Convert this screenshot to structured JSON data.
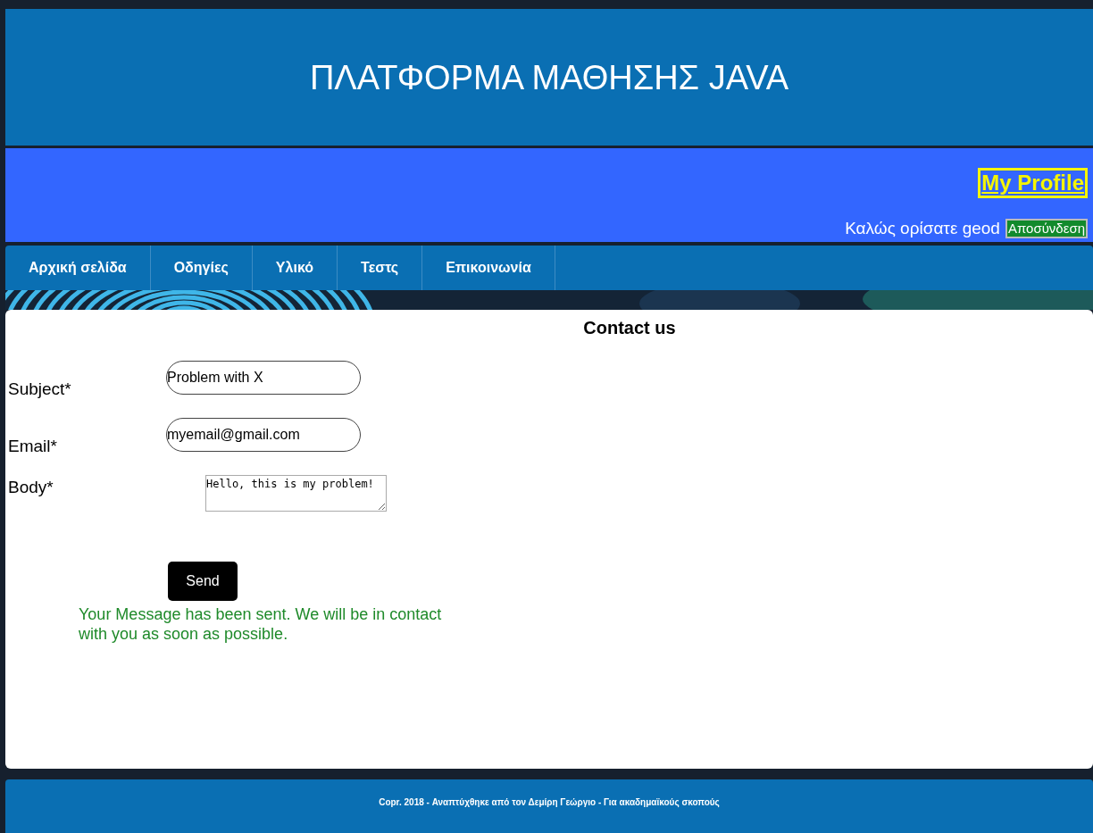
{
  "header": {
    "title": "ΠΛΑΤΦΟΡΜΑ ΜΑΘΗΣΗΣ JAVA"
  },
  "user_bar": {
    "profile_link": "My Profile",
    "welcome": "Καλώς ορίσατε geod",
    "logout_button": "Αποσύνδεση"
  },
  "nav": {
    "items": [
      "Αρχική σελίδα",
      "Οδηγίες",
      "Υλικό",
      "Τεστς",
      "Επικοινωνία"
    ]
  },
  "contact": {
    "title": "Contact us",
    "fields": [
      {
        "kind": "input",
        "label": "Subject*",
        "value": "Problem with X"
      },
      {
        "kind": "input",
        "label": "Email*",
        "value": "myemail@gmail.com"
      },
      {
        "kind": "textarea",
        "label": "Body*",
        "value": "Hello, this is my problem!"
      }
    ],
    "send_button": "Send",
    "message": "Your Message has been sent. We will be in contact with you as soon as possible."
  },
  "footer": {
    "text": "Copr. 2018 - Αναπτύχθηκε από τον Δεμίρη Γεώργιο - Για ακαδημαϊκούς σκοπούς"
  }
}
